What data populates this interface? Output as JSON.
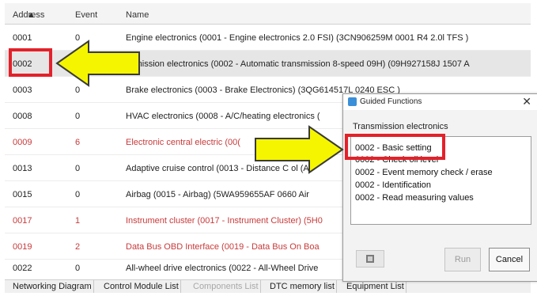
{
  "columns": {
    "address": "Address",
    "event": "Event",
    "name": "Name"
  },
  "rows": [
    {
      "address": "0001",
      "event": "0",
      "name": "Engine electronics (0001 - Engine electronics 2.0 FSI) (3CN906259M   0001  R4 2.0l TFS )"
    },
    {
      "address": "0002",
      "event": "",
      "name": "nsmission electronics (0002 - Automatic transmission 8-speed 09H) (09H927158J   1507  A"
    },
    {
      "address": "0003",
      "event": "0",
      "name": "Brake electronics (0003 - Brake Electronics) (3QG614517L   0240  ESC       )"
    },
    {
      "address": "0008",
      "event": "0",
      "name": "HVAC electronics (0008 - A/C/heating electronics ("
    },
    {
      "address": "0009",
      "event": "6",
      "name": "Electronic central electric (00("
    },
    {
      "address": "0013",
      "event": "0",
      "name": "Adaptive cruise control (0013 - Distance C    ol (A"
    },
    {
      "address": "0015",
      "event": "0",
      "name": "Airbag (0015 - Airbag) (5WA959655AF   0660   Air"
    },
    {
      "address": "0017",
      "event": "1",
      "name": "Instrument cluster (0017 - Instrument Cluster) (5H0"
    },
    {
      "address": "0019",
      "event": "2",
      "name": "Data Bus OBD Interface (0019 - Data Bus On Boa"
    },
    {
      "address": "0022",
      "event": "0",
      "name": "All-wheel drive electronics (0022 - All-Wheel Drive"
    }
  ],
  "tabs": [
    "Networking Diagram",
    "Control Module List",
    "Components List",
    "DTC memory list",
    "Equipment List"
  ],
  "dialog": {
    "title": "Guided Functions",
    "close": "✕",
    "subtitle": "Transmission electronics",
    "items": [
      "0002 - Basic setting",
      "0002 - Check oil level",
      "0002 - Event memory check / erase",
      "0002 - Identification",
      "0002 - Read measuring values"
    ],
    "run": "Run",
    "cancel": "Cancel"
  },
  "colors": {
    "highlight": "#e3212a",
    "arrow_fill": "#f5f500",
    "fault_text": "#c83a3a"
  }
}
